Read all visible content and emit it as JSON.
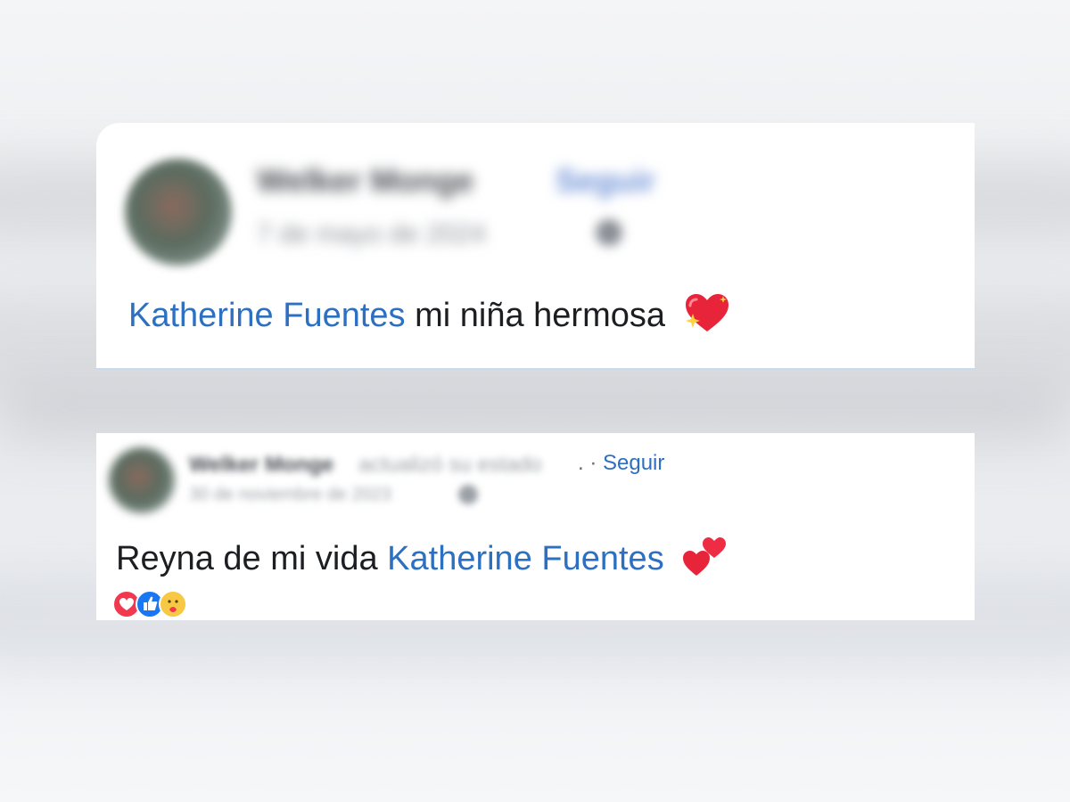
{
  "posts": [
    {
      "author": "Welker Monge",
      "follow_label": "Seguir",
      "date": "7 de mayo de 2024",
      "mention": "Katherine Fuentes",
      "text": "mi niña hermosa",
      "emoji_icon": "sparkling-heart-icon"
    },
    {
      "author": "Welker Monge",
      "action": "actualizó su estado",
      "separator": ". · ",
      "follow_label": "Seguir",
      "date": "30 de noviembre de 2023",
      "text_before": "Reyna de mi vida",
      "mention": "Katherine Fuentes",
      "emoji_icon": "two-hearts-icon",
      "reactions": [
        "love-reaction-icon",
        "like-reaction-icon",
        "care-reaction-icon"
      ]
    }
  ],
  "colors": {
    "link": "#2d6fc1",
    "text": "#1c1e21",
    "love": "#f0384e",
    "like": "#1a77f2",
    "care": "#f7c843"
  }
}
